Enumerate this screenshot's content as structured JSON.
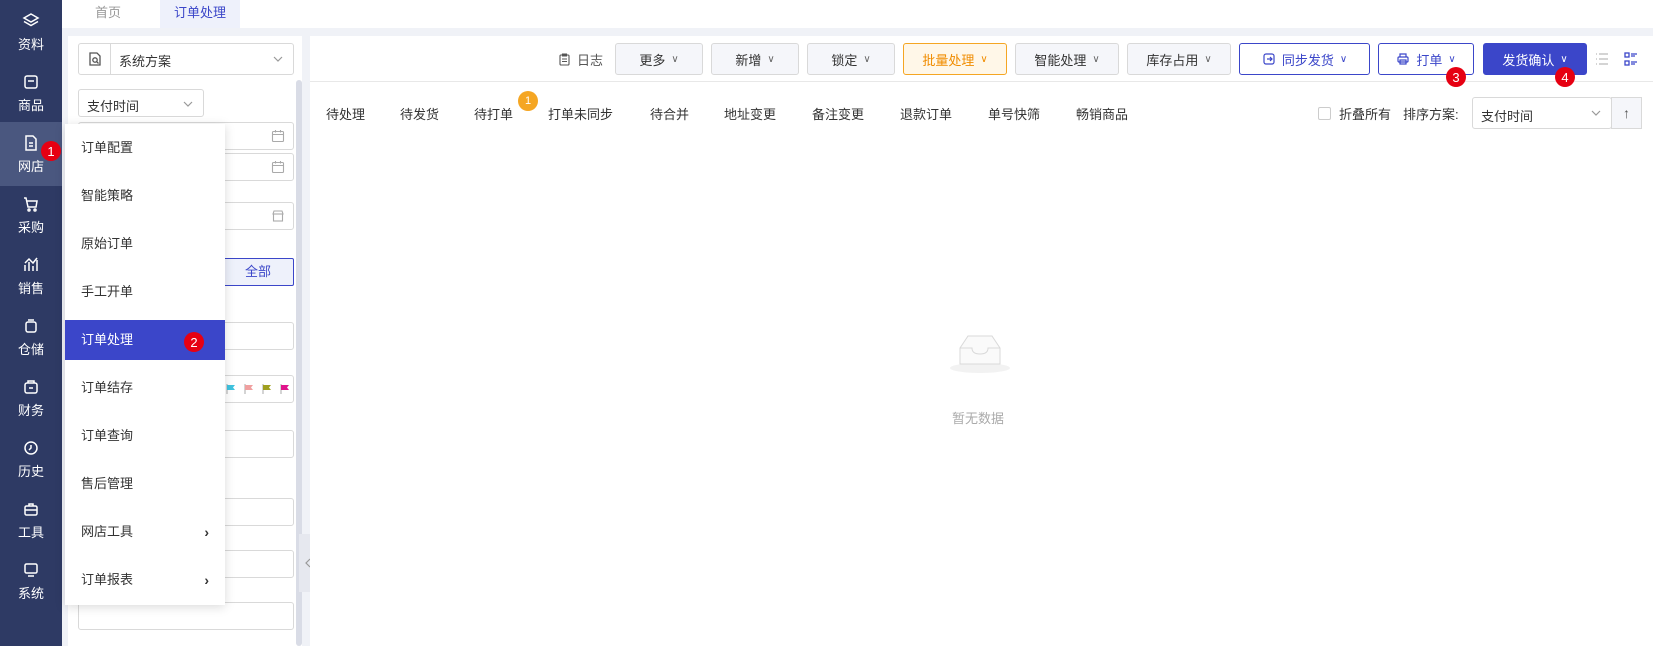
{
  "rail": {
    "items": [
      {
        "label": "资料",
        "icon": "layers-icon"
      },
      {
        "label": "商品",
        "icon": "box-icon"
      },
      {
        "label": "网店",
        "icon": "document-icon",
        "active": true
      },
      {
        "label": "采购",
        "icon": "cart-icon"
      },
      {
        "label": "销售",
        "icon": "chart-icon"
      },
      {
        "label": "仓储",
        "icon": "warehouse-icon"
      },
      {
        "label": "财务",
        "icon": "wallet-icon"
      },
      {
        "label": "历史",
        "icon": "clock-icon"
      },
      {
        "label": "工具",
        "icon": "toolbox-icon"
      },
      {
        "label": "系统",
        "icon": "monitor-icon"
      }
    ]
  },
  "tabs": [
    {
      "label": "首页"
    },
    {
      "label": "订单处理",
      "active": true
    }
  ],
  "filter": {
    "scheme": "系统方案",
    "time_select": "支付时间",
    "all_button": "全部"
  },
  "menu": {
    "items": [
      {
        "label": "订单配置"
      },
      {
        "label": "智能策略"
      },
      {
        "label": "原始订单"
      },
      {
        "label": "手工开单"
      },
      {
        "label": "订单处理",
        "selected": true
      },
      {
        "label": "订单结存"
      },
      {
        "label": "订单查询"
      },
      {
        "label": "售后管理"
      },
      {
        "label": "网店工具",
        "submenu": true
      },
      {
        "label": "订单报表",
        "submenu": true
      }
    ]
  },
  "markers": [
    "1",
    "2",
    "3",
    "4"
  ],
  "toolbar": {
    "log": "日志",
    "buttons": [
      {
        "label": "更多"
      },
      {
        "label": "新增"
      },
      {
        "label": "锁定"
      },
      {
        "label": "批量处理"
      },
      {
        "label": "智能处理"
      },
      {
        "label": "库存占用"
      },
      {
        "label": "同步发货"
      },
      {
        "label": "打单"
      },
      {
        "label": "发货确认"
      }
    ]
  },
  "order_tabs": [
    "待处理",
    "待发货",
    "待打单",
    "打单未同步",
    "待合并",
    "地址变更",
    "备注变更",
    "退款订单",
    "单号快筛",
    "畅销商品"
  ],
  "badge": "1",
  "fold_all": "折叠所有",
  "sort": {
    "label": "排序方案:",
    "value": "支付时间",
    "direction_icon": "↑"
  },
  "empty": {
    "text": "暂无数据"
  },
  "colors": {
    "rail_bg": "#2e3a64",
    "primary": "#3b46c9",
    "orange": "#f5a623",
    "marker_red": "#e60012"
  }
}
